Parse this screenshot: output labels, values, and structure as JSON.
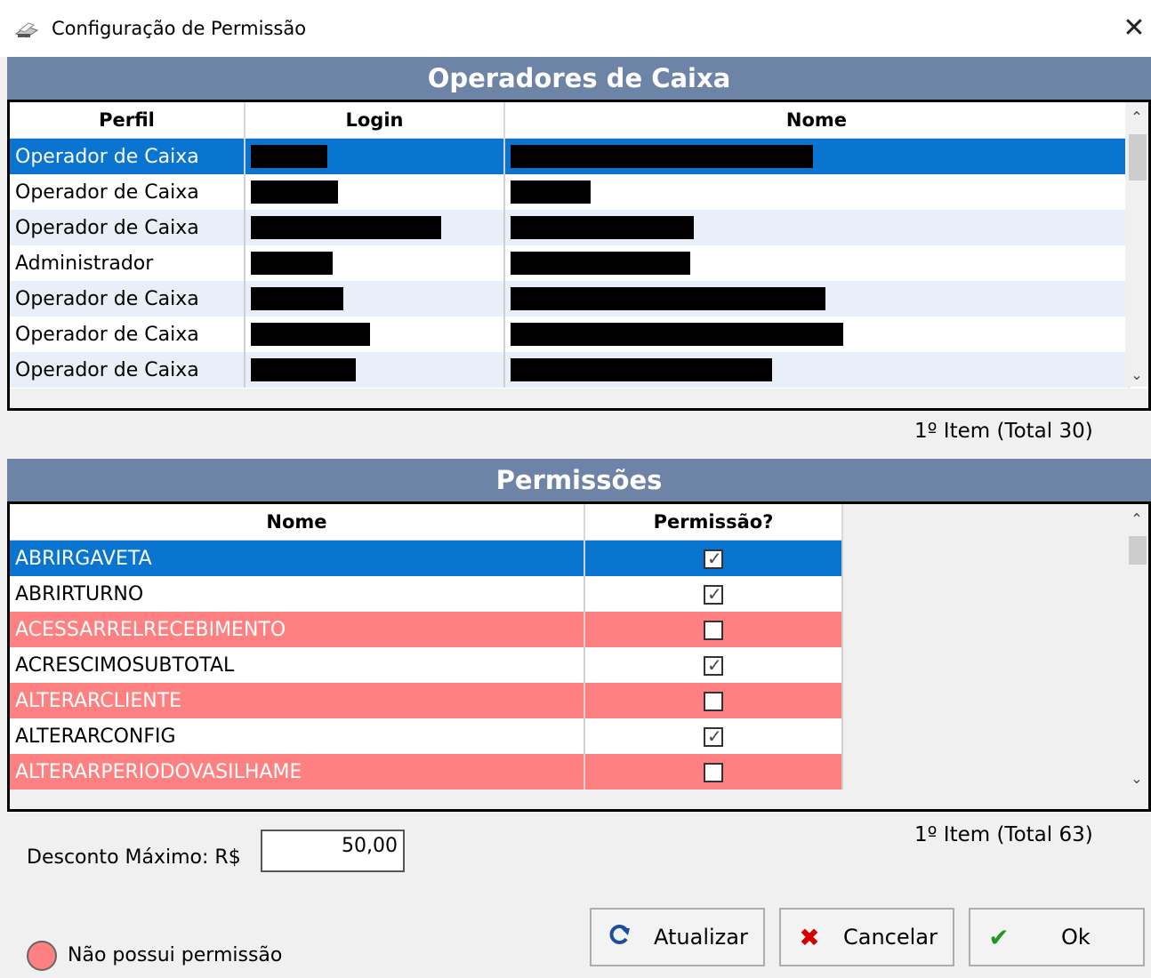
{
  "window": {
    "title": "Configuração de Permissão",
    "close_glyph": "✕"
  },
  "operators": {
    "section_title": "Operadores de Caixa",
    "columns": [
      "Perfil",
      "Login",
      "Nome"
    ],
    "rows": [
      {
        "perfil": "Operador de Caixa",
        "selected": true
      },
      {
        "perfil": "Operador de Caixa"
      },
      {
        "perfil": "Operador de Caixa"
      },
      {
        "perfil": "Administrador"
      },
      {
        "perfil": "Operador de Caixa"
      },
      {
        "perfil": "Operador de Caixa"
      },
      {
        "perfil": "Operador de Caixa"
      }
    ],
    "status": "1º Item (Total 30)"
  },
  "permissions": {
    "section_title": "Permissões",
    "columns": [
      "Nome",
      "Permissão?"
    ],
    "rows": [
      {
        "nome": "ABRIRGAVETA",
        "permitted": true,
        "selected": true
      },
      {
        "nome": "ABRIRTURNO",
        "permitted": true
      },
      {
        "nome": "ACESSARRELRECEBIMENTO",
        "permitted": false
      },
      {
        "nome": "ACRESCIMOSUBTOTAL",
        "permitted": true
      },
      {
        "nome": "ALTERARCLIENTE",
        "permitted": false
      },
      {
        "nome": "ALTERARCONFIG",
        "permitted": true
      },
      {
        "nome": "ALTERARPERIODOVASILHAME",
        "permitted": false
      }
    ],
    "status": "1º Item (Total 63)"
  },
  "discount": {
    "label": "Desconto Máximo: R$",
    "value": "50,00"
  },
  "legend": {
    "text": "Não possui permissão"
  },
  "buttons": {
    "refresh": "Atualizar",
    "cancel": "Cancelar",
    "ok": "Ok"
  },
  "colors": {
    "header_bar": "#6e84a6",
    "selection": "#0a74d1",
    "denied_row": "#ff8080",
    "alt_row": "#e8eff8"
  },
  "icons": {
    "window": "printer-icon",
    "refresh": "refresh-icon",
    "cancel": "x-icon",
    "ok": "checkmark-icon"
  }
}
